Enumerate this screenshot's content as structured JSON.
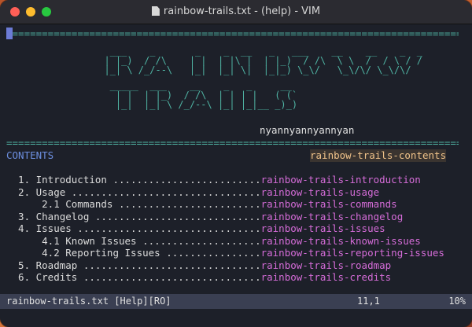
{
  "window": {
    "title": "rainbow-trails.txt - (help) - VIM"
  },
  "buffer": {
    "separator": "===============================================================================================",
    "logo_lines": [
      "   ___    _       _    _  __   _   ___    __    __    _  _",
      "  | |_)  / /\\    | |  | |\\ |  | |_)  / /\\  \\ \\  /  / \\ / /",
      "  |_| \\ /_/--\\   |_|  |_| \\|  |_|_) \\_\\/   \\_\\/\\/ \\_\\/\\/",
      "   _____  ___    __    _   _     __",
      "    | |  | |_)  / /\\  | | | |   ( (`",
      "    |_|  |_| \\ /_/--\\ |_| |_|__ _)_)"
    ],
    "author": "nyannyannyannyan",
    "contents_label": "CONTENTS",
    "contents_tag": "rainbow-trails-contents",
    "toc": [
      {
        "text": "  1. Introduction .........................",
        "link": "rainbow-trails-introduction"
      },
      {
        "text": "  2. Usage ................................",
        "link": "rainbow-trails-usage"
      },
      {
        "text": "      2.1 Commands ........................",
        "link": "rainbow-trails-commands"
      },
      {
        "text": "  3. Changelog ............................",
        "link": "rainbow-trails-changelog"
      },
      {
        "text": "  4. Issues ...............................",
        "link": "rainbow-trails-issues"
      },
      {
        "text": "      4.1 Known Issues ....................",
        "link": "rainbow-trails-known-issues"
      },
      {
        "text": "      4.2 Reporting Issues ................",
        "link": "rainbow-trails-reporting-issues"
      },
      {
        "text": "  5. Roadmap ..............................",
        "link": "rainbow-trails-roadmap"
      },
      {
        "text": "  6. Credits ..............................",
        "link": "rainbow-trails-credits"
      }
    ]
  },
  "statusbar": {
    "file": "rainbow-trails.txt [Help][RO]",
    "position": "11,1",
    "percent": "10%"
  },
  "colors": {
    "background": "#1d2029",
    "separator": "#4fb3a3",
    "link": "#d56cd8",
    "tag_highlight": "#f0c38a",
    "cursor": "#6c7bd6"
  },
  "icons": [
    "close-button",
    "minimize-button",
    "zoom-button",
    "document-icon"
  ]
}
